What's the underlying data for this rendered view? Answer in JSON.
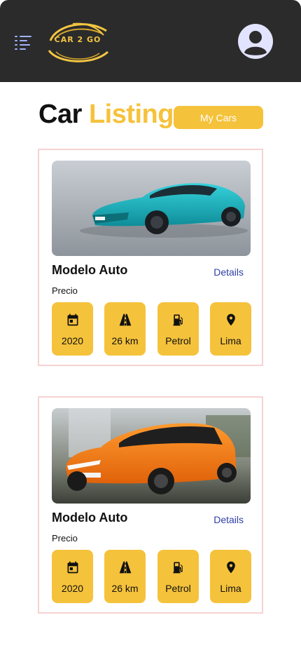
{
  "header": {
    "logo_text": "CAR 2 GO",
    "menu_icon": "menu-icon",
    "avatar_icon": "user-avatar-icon"
  },
  "page": {
    "title_part1": "Car",
    "title_part2": "Listing",
    "my_cars_label": "My Cars"
  },
  "cars": [
    {
      "name": "Modelo Auto",
      "details_label": "Details",
      "price_label": "Precio",
      "photo": "teal sedan car photo",
      "specs": {
        "year": "2020",
        "mileage": "26 km",
        "fuel": "Petrol",
        "location": "Lima"
      }
    },
    {
      "name": "Modelo Auto",
      "details_label": "Details",
      "price_label": "Precio",
      "photo": "orange hatchback car photo",
      "specs": {
        "year": "2020",
        "mileage": "26 km",
        "fuel": "Petrol",
        "location": "Lima"
      }
    }
  ],
  "colors": {
    "topbar": "#2b2b2b",
    "accent": "#f5c23b",
    "card_border": "#f7d3d3",
    "link": "#2f3fa6",
    "avatar_bg": "#e2e3ff"
  }
}
